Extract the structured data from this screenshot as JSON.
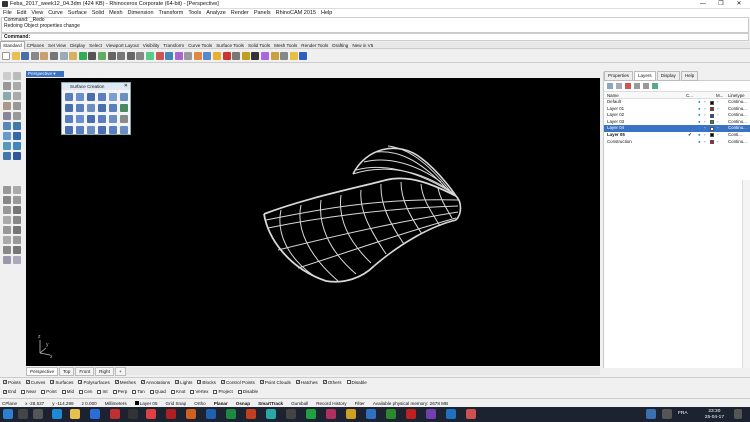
{
  "window": {
    "title": "Feba_2017_week12_04.3dm (424 KB) - Rhinoceros Corporate (64-bit) - [Perspective]",
    "minimize": "—",
    "maximize": "❐",
    "close": "✕"
  },
  "menu": [
    "File",
    "Edit",
    "View",
    "Curve",
    "Surface",
    "Solid",
    "Mesh",
    "Dimension",
    "Transform",
    "Tools",
    "Analyze",
    "Render",
    "Panels",
    "RhinoCAM 2015",
    "Help"
  ],
  "command": {
    "history": [
      "Command: _Redo",
      "Redoing Object properties change"
    ],
    "prompt": "Command:"
  },
  "toolbar_tabs": [
    "Standard",
    "CPlanes",
    "Set View",
    "Display",
    "Select",
    "Viewport Layout",
    "Visibility",
    "Transform",
    "Curve Tools",
    "Surface Tools",
    "Solid Tools",
    "Mesh Tools",
    "Render Tools",
    "Drafting",
    "New in V5"
  ],
  "viewport": {
    "title": "Perspective",
    "tabs": [
      "Perspective",
      "Top",
      "Front",
      "Right"
    ],
    "add_tab": "+",
    "axis_x": "x",
    "axis_y": "y",
    "axis_z": "z"
  },
  "surface_panel": {
    "title": "Surface Creation"
  },
  "right_panel": {
    "tabs": [
      "Properties",
      "Layers",
      "Display",
      "Help"
    ],
    "columns": {
      "name": "Name",
      "current": "C...",
      "material": "M...",
      "linetype": "Linetype"
    },
    "layers": [
      {
        "name": "Default",
        "current": "",
        "color": "#000000",
        "linetype": "Continu...",
        "selected": false,
        "bold": false
      },
      {
        "name": "Layer 01",
        "current": "",
        "color": "#d01010",
        "linetype": "Continu...",
        "selected": false,
        "bold": false
      },
      {
        "name": "Layer 02",
        "current": "",
        "color": "#2040d0",
        "linetype": "Continu...",
        "selected": false,
        "bold": false
      },
      {
        "name": "Layer 03",
        "current": "",
        "color": "#10a010",
        "linetype": "Continu...",
        "selected": false,
        "bold": false
      },
      {
        "name": "Layer 04",
        "current": "",
        "color": "#ffffff",
        "linetype": "Continu...",
        "selected": true,
        "bold": false
      },
      {
        "name": "Layer 05",
        "current": "✔",
        "color": "#000000",
        "linetype": "Conti...",
        "selected": false,
        "bold": true
      },
      {
        "name": "Construction",
        "current": "",
        "color": "#d01010",
        "linetype": "Continu...",
        "selected": false,
        "bold": false
      }
    ]
  },
  "osnap_filter": [
    "Points",
    "Curves",
    "Surfaces",
    "Polysurfaces",
    "Meshes",
    "Annotations",
    "Lights",
    "Blocks",
    "Control Points",
    "Point Clouds",
    "Hatches",
    "Others",
    "Disable"
  ],
  "osnap_filter_checked": [
    true,
    true,
    true,
    true,
    true,
    true,
    true,
    true,
    true,
    true,
    true,
    true,
    false
  ],
  "osnap": [
    "End",
    "Near",
    "Point",
    "Mid",
    "Cen",
    "Int",
    "Perp",
    "Tan",
    "Quad",
    "Knot",
    "Vertex",
    "Project",
    "Disable"
  ],
  "osnap_checked": [
    true,
    false,
    false,
    false,
    false,
    false,
    false,
    false,
    false,
    false,
    false,
    false,
    false
  ],
  "status": {
    "cplane": "CPlane",
    "x": "x -28.537",
    "y": "y -114.299",
    "z": "z 0.000",
    "units": "Millimeters",
    "layer": "Layer 05",
    "items": [
      "Grid Snap",
      "Ortho",
      "Planar",
      "Osnap",
      "SmartTrack",
      "Gumball",
      "Record History",
      "Filter",
      "Available physical memory: 2678 MB"
    ],
    "bold_items": [
      false,
      false,
      true,
      true,
      true,
      false,
      false,
      false,
      false
    ]
  },
  "clock": {
    "time": "23:30",
    "date": "25-04-17",
    "lang": "FRA"
  }
}
